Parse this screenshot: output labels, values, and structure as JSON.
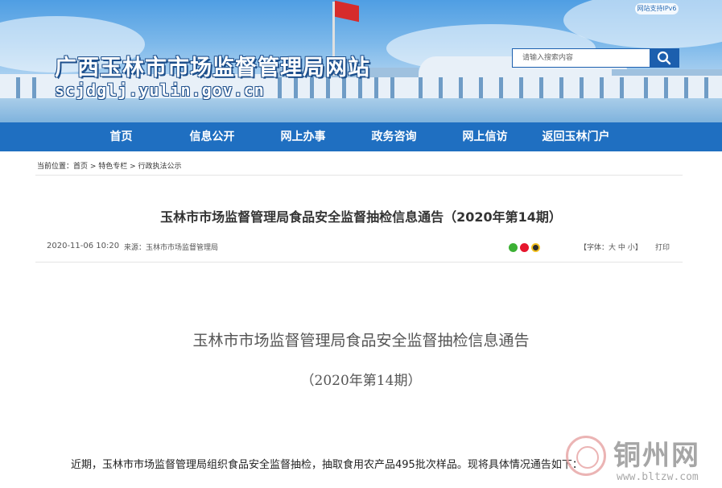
{
  "header": {
    "site_title": "广西玉林市市场监督管理局网站",
    "site_domain": "scjdglj.yulin.gov.cn",
    "ipv6_badge": "网站支持IPv6",
    "search": {
      "placeholder": "请输入搜索内容"
    }
  },
  "nav": {
    "items": [
      {
        "label": "首页"
      },
      {
        "label": "信息公开"
      },
      {
        "label": "网上办事"
      },
      {
        "label": "政务咨询"
      },
      {
        "label": "网上信访"
      },
      {
        "label": "返回玉林门户"
      }
    ]
  },
  "breadcrumb": {
    "text": "当前位置：首页 > 特色专栏 > 行政执法公示"
  },
  "article": {
    "title": "玉林市市场监督管理局食品安全监督抽检信息通告（2020年第14期）",
    "date": "2020-11-06 10:20",
    "source": "来源：玉林市市场监督管理局",
    "font_size_label": "【字体：",
    "font_large": "大",
    "font_medium": "中",
    "font_small": "小",
    "font_close": "】",
    "print_label": "打印",
    "body_title": "玉林市市场监督管理局食品安全监督抽检信息通告",
    "body_subtitle": "（2020年第14期）",
    "body_paragraph": "近期，玉林市市场监督管理局组织食品安全监督抽检，抽取食用农产品495批次样品。现将具体情况通告如下："
  },
  "watermark": {
    "text": "铜州网",
    "url": "www.bltzw.com"
  },
  "colors": {
    "nav_bg": "#1f6fc1",
    "search_btn": "#1c5fae"
  }
}
